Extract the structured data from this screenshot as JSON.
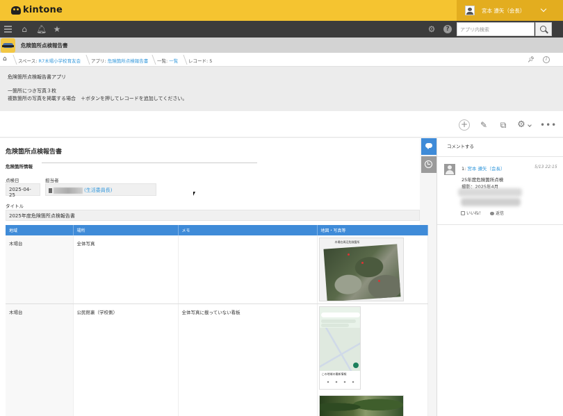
{
  "header": {
    "logo_text": "kintone",
    "user_name": "宮本 遵矢（会長）",
    "search_placeholder": "アプリ内検索"
  },
  "app": {
    "title": "危険箇所点検報告書",
    "icon": "app-icon-goggles"
  },
  "breadcrumb": {
    "space_prefix": "スペース: ",
    "space_name": "R7木場小学校育友会",
    "app_prefix": "アプリ: ",
    "app_name": "危険箇所点検報告書",
    "view_prefix": "一覧: ",
    "view_name": "一覧",
    "record": "レコード: 5"
  },
  "description": {
    "line1": "危険箇所点検報告書アプリ",
    "line2": "一箇所につき写真３枚",
    "line3": "複数箇所の写真を掲載する場合　＋ボタンを押してレコードを追加してください。"
  },
  "record": {
    "title": "危険箇所点検報告書",
    "group_label": "危険箇所情報",
    "date_label": "点検日",
    "date_value": "2025-04-25",
    "person_label": "担当者",
    "person_value": "(生活委員長)",
    "title_label": "タイトル",
    "title_value": "2025年度危険箇所点検報告書"
  },
  "table": {
    "headers": [
      "地域",
      "場所",
      "メモ",
      "地図・写真等"
    ],
    "rows": [
      {
        "area": "木場台",
        "place": "全体写真",
        "memo": ""
      },
      {
        "area": "木場台",
        "place": "公民館裏（学校側）",
        "memo": "全体写真に載っていない看板"
      }
    ],
    "aerial_caption": "木場台周辺危険箇所",
    "phone_caption": "この地域の最新情報"
  },
  "comments": {
    "prompt": "コメントする",
    "items": [
      {
        "index": "1:",
        "author": "宮本 遵矢（会長）",
        "time": "5/13 22:15",
        "line1": "25年度危険箇所点検",
        "line2": "撮影：2025年4月",
        "like_label": "いいね！",
        "reply_label": "返信"
      }
    ]
  },
  "colors": {
    "header_yellow": "#f5c430",
    "nav_dark": "#3c3c3c",
    "accent_blue": "#3f8bd8",
    "link_blue": "#3498db"
  }
}
